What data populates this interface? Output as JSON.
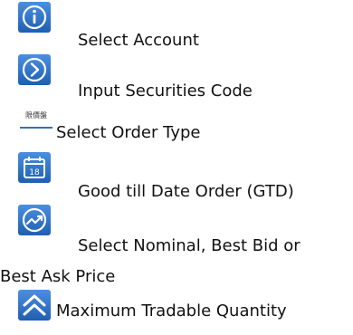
{
  "colors": {
    "icon_blue": "#2f73c8",
    "icon_dark": "#1a4f93",
    "text": "#111111"
  },
  "items": [
    {
      "label": "Select Account",
      "icon": "info-icon"
    },
    {
      "label": "Input Securities Code",
      "icon": "chevron-right-circle-icon"
    },
    {
      "label": "Select Order Type",
      "icon": "order-type-tag-icon",
      "icon_text": "限價盤"
    },
    {
      "label": "Good till Date Order (GTD)",
      "icon": "calendar-icon",
      "icon_text": "18"
    },
    {
      "label_line1": "Select Nominal, Best Bid or",
      "label_line2": "Best Ask Price",
      "icon": "trend-circle-icon"
    },
    {
      "label": "Maximum Tradable Quantity",
      "icon": "double-chevron-up-icon"
    }
  ]
}
